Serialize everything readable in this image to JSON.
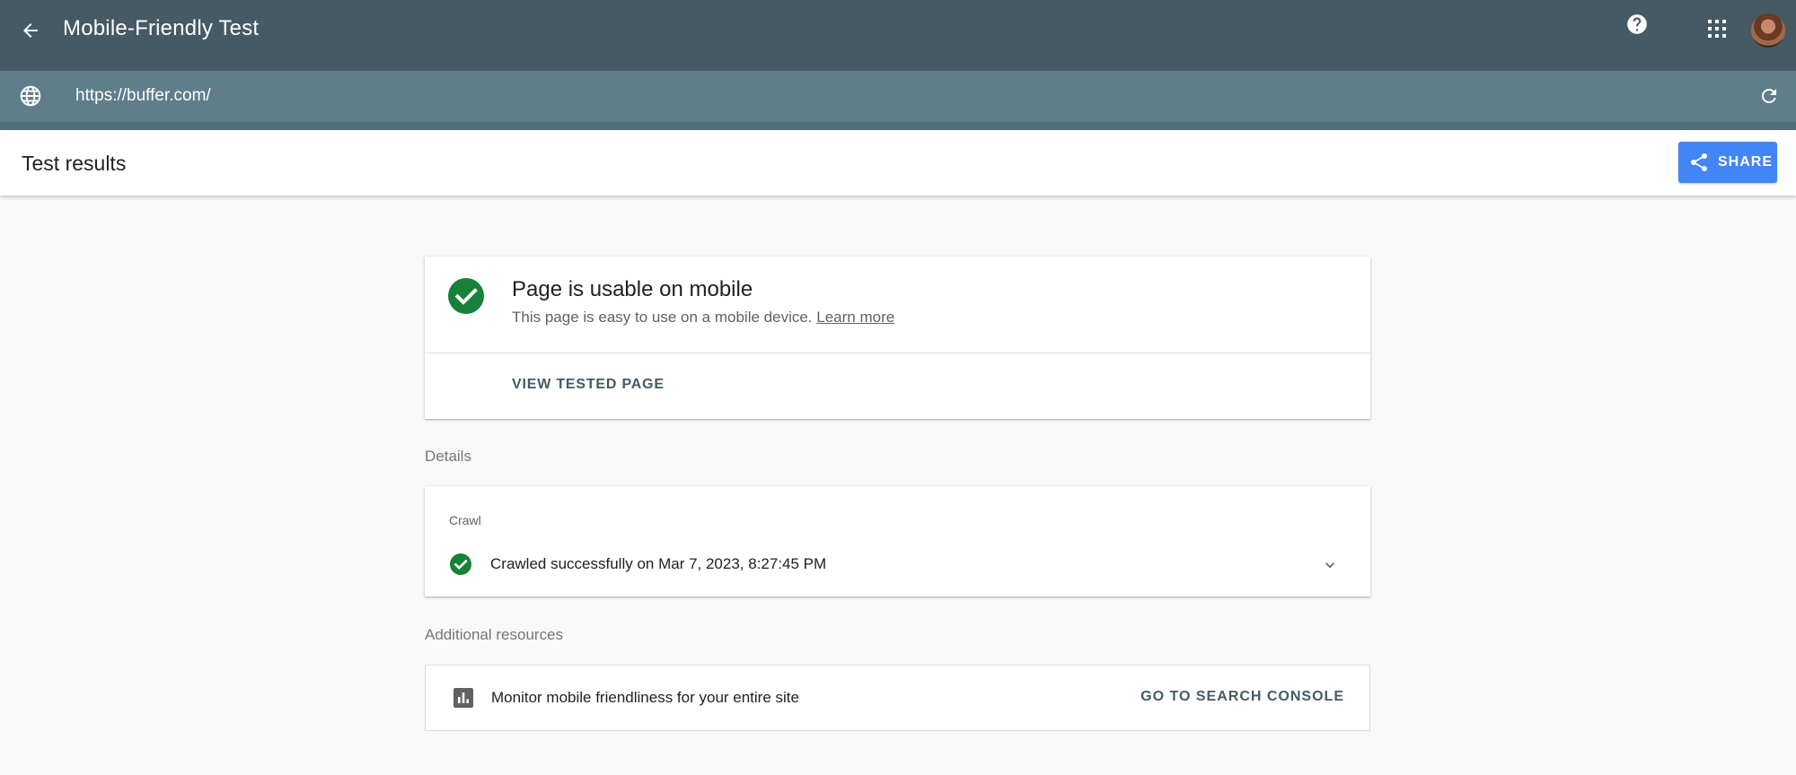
{
  "app": {
    "title": "Mobile-Friendly Test",
    "back_icon": "arrow-back-icon",
    "help_icon": "help-icon",
    "apps_icon": "apps-grid-icon"
  },
  "urlbar": {
    "url": "https://buffer.com/",
    "globe_icon": "globe-icon",
    "reload_icon": "reload-icon"
  },
  "results": {
    "title": "Test results",
    "share_label": "SHARE",
    "share_color": "#4285f4"
  },
  "status": {
    "title": "Page is usable on mobile",
    "description": "This page is easy to use on a mobile device.",
    "learn_more": "Learn more",
    "view_tested_page": "VIEW TESTED PAGE",
    "success_color": "#188038"
  },
  "details": {
    "label": "Details",
    "crawl_label": "Crawl",
    "crawl_text": "Crawled successfully on Mar 7, 2023, 8:27:45 PM"
  },
  "resources": {
    "label": "Additional resources",
    "monitor_text": "Monitor mobile friendliness for your entire site",
    "console_button": "GO TO SEARCH CONSOLE"
  },
  "colors": {
    "topbar": "#455a64",
    "urlbar": "#607d8b"
  }
}
